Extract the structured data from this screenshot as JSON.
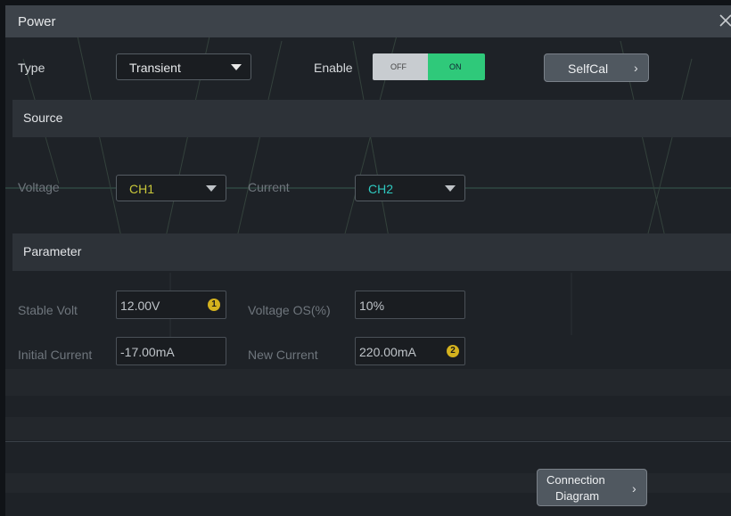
{
  "dialog": {
    "title": "Power"
  },
  "type": {
    "label": "Type",
    "value": "Transient"
  },
  "enable": {
    "label": "Enable",
    "off": "OFF",
    "on": "ON",
    "state": "ON"
  },
  "selfcal": {
    "label": "SelfCal"
  },
  "source": {
    "title": "Source",
    "voltage_label": "Voltage",
    "voltage_value": "CH1",
    "current_label": "Current",
    "current_value": "CH2"
  },
  "parameter": {
    "title": "Parameter",
    "stable_volt_label": "Stable Volt",
    "stable_volt_value": "12.00V",
    "badge1": "1",
    "voltage_os_label": "Voltage OS(%)",
    "voltage_os_value": "10%",
    "initial_current_label": "Initial Current",
    "initial_current_value": "-17.00mA",
    "new_current_label": "New Current",
    "new_current_value": "220.00mA",
    "badge2": "2"
  },
  "connection": {
    "line1": "Connection",
    "line2": "Diagram"
  },
  "colors": {
    "ch1": "#c9c83a",
    "ch2": "#2fc9c0",
    "on": "#2fc97a",
    "badge": "#d4b21e"
  }
}
